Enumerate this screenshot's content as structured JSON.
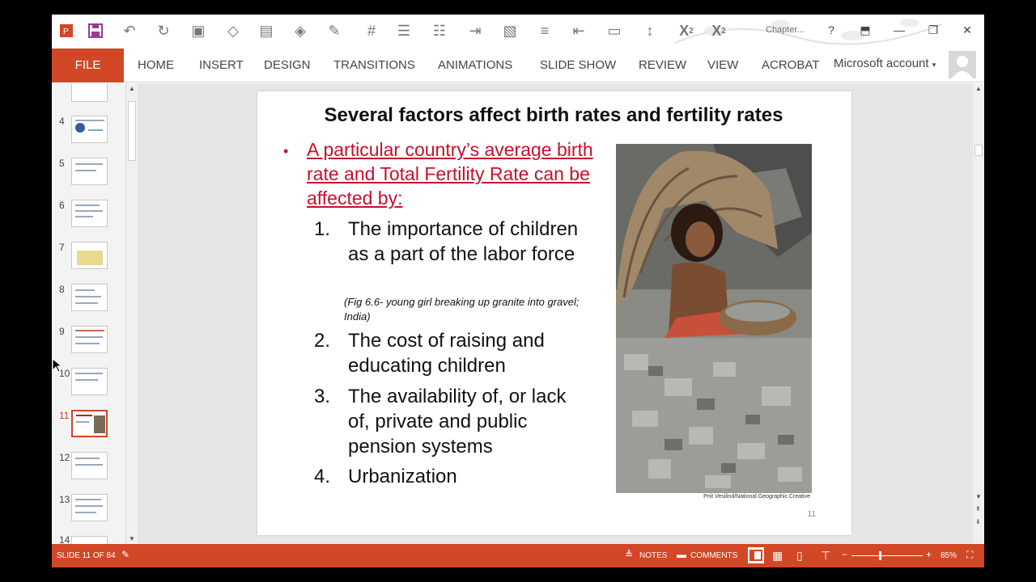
{
  "window": {
    "doc_title": "Chapter...",
    "help": "?"
  },
  "ribbon": {
    "file_tab": "FILE",
    "tabs": [
      "HOME",
      "INSERT",
      "DESIGN",
      "TRANSITIONS",
      "ANIMATIONS",
      "SLIDE SHOW",
      "REVIEW",
      "VIEW",
      "ACROBAT"
    ],
    "account": "Microsoft account"
  },
  "thumbnails": {
    "numbers": [
      "4",
      "5",
      "6",
      "7",
      "8",
      "9",
      "10",
      "11",
      "12",
      "13",
      "14"
    ],
    "selected": "11"
  },
  "slide": {
    "title": "Several factors affect birth rates and fertility rates",
    "bullet": "A particular country’s average birth rate and Total Fertility Rate can be affected by:",
    "items": [
      {
        "num": "1.",
        "text": "The importance of children as a part of the labor force"
      },
      {
        "num": "2.",
        "text": "The cost of raising and educating children"
      },
      {
        "num": "3.",
        "text": "The availability of, or lack of, private and public pension systems"
      },
      {
        "num": "4.",
        "text": "Urbanization"
      }
    ],
    "caption": "(Fig 6.6- young girl breaking up granite into gravel; India)",
    "photo_credit": "Priit Vesilind/National Geographic Creative",
    "page_number": "11"
  },
  "status": {
    "slide_of": "SLIDE 11 OF 84",
    "notes": "NOTES",
    "comments": "COMMENTS",
    "zoom": "85%"
  },
  "colors": {
    "accent": "#d24726",
    "bullet_red": "#c8102e"
  }
}
